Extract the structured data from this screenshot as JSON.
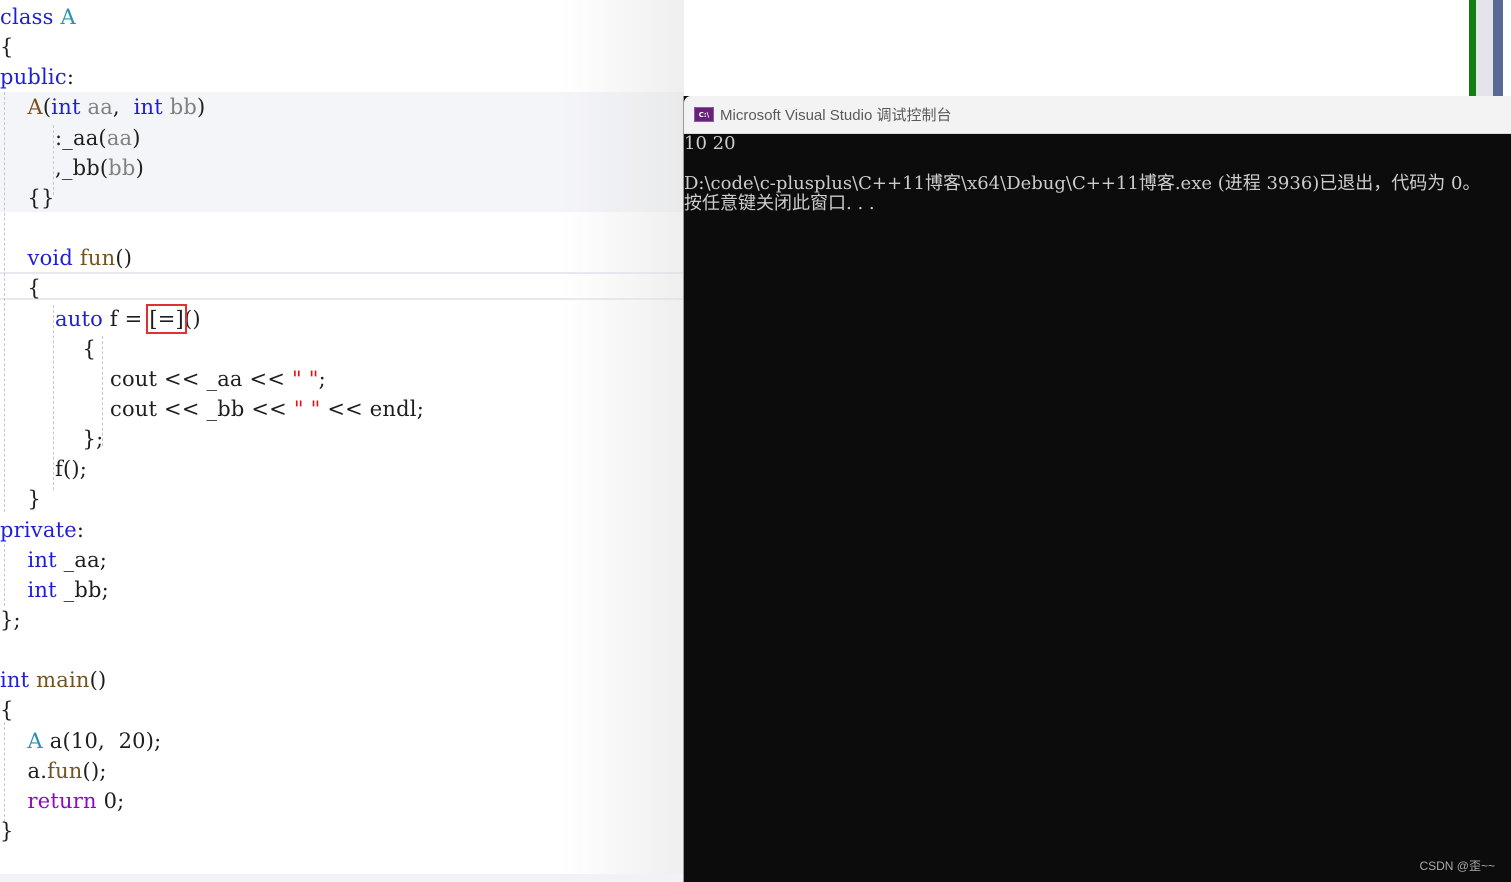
{
  "editor": {
    "lines": [
      {
        "tokens": [
          {
            "t": "class",
            "c": "kw"
          },
          {
            "t": " "
          },
          {
            "t": "A",
            "c": "cls"
          }
        ]
      },
      {
        "tokens": [
          {
            "t": "{"
          }
        ]
      },
      {
        "tokens": [
          {
            "t": "public",
            "c": "kw"
          },
          {
            "t": ":"
          }
        ]
      },
      {
        "tokens": [
          {
            "t": "    "
          },
          {
            "t": "A",
            "c": "fn"
          },
          {
            "t": "("
          },
          {
            "t": "int",
            "c": "kw"
          },
          {
            "t": " "
          },
          {
            "t": "aa",
            "c": "param"
          },
          {
            "t": ",  "
          },
          {
            "t": "int",
            "c": "kw"
          },
          {
            "t": " "
          },
          {
            "t": "bb",
            "c": "param"
          },
          {
            "t": ")"
          }
        ]
      },
      {
        "tokens": [
          {
            "t": "        :_aa("
          },
          {
            "t": "aa",
            "c": "param"
          },
          {
            "t": ")"
          }
        ]
      },
      {
        "tokens": [
          {
            "t": "        ,_bb("
          },
          {
            "t": "bb",
            "c": "param"
          },
          {
            "t": ")"
          }
        ]
      },
      {
        "tokens": [
          {
            "t": "    {}"
          }
        ]
      },
      {
        "tokens": []
      },
      {
        "tokens": [
          {
            "t": "    "
          },
          {
            "t": "void",
            "c": "kw"
          },
          {
            "t": " "
          },
          {
            "t": "fun",
            "c": "fn"
          },
          {
            "t": "()"
          }
        ]
      },
      {
        "tokens": [
          {
            "t": "    {"
          }
        ]
      },
      {
        "tokens": [
          {
            "t": "        "
          },
          {
            "t": "auto",
            "c": "kw"
          },
          {
            "t": " f = "
          },
          {
            "t": "[=]",
            "c": "capture"
          },
          {
            "t": "()"
          }
        ]
      },
      {
        "tokens": [
          {
            "t": "            {"
          }
        ]
      },
      {
        "tokens": [
          {
            "t": "                cout << _aa << "
          },
          {
            "t": "\" \"",
            "c": "str"
          },
          {
            "t": ";"
          }
        ]
      },
      {
        "tokens": [
          {
            "t": "                cout << _bb << "
          },
          {
            "t": "\" \"",
            "c": "str"
          },
          {
            "t": " << endl;"
          }
        ]
      },
      {
        "tokens": [
          {
            "t": "            };"
          }
        ]
      },
      {
        "tokens": [
          {
            "t": "        f();"
          }
        ]
      },
      {
        "tokens": [
          {
            "t": "    }"
          }
        ]
      },
      {
        "tokens": [
          {
            "t": "private",
            "c": "kw"
          },
          {
            "t": ":"
          }
        ]
      },
      {
        "tokens": [
          {
            "t": "    "
          },
          {
            "t": "int",
            "c": "kw"
          },
          {
            "t": " _aa;"
          }
        ]
      },
      {
        "tokens": [
          {
            "t": "    "
          },
          {
            "t": "int",
            "c": "kw"
          },
          {
            "t": " _bb;"
          }
        ]
      },
      {
        "tokens": [
          {
            "t": "};"
          }
        ]
      },
      {
        "tokens": []
      },
      {
        "tokens": [
          {
            "t": "int",
            "c": "kw"
          },
          {
            "t": " "
          },
          {
            "t": "main",
            "c": "fn"
          },
          {
            "t": "()"
          }
        ]
      },
      {
        "tokens": [
          {
            "t": "{"
          }
        ]
      },
      {
        "tokens": [
          {
            "t": "    "
          },
          {
            "t": "A",
            "c": "cls"
          },
          {
            "t": " a(10,  20);"
          }
        ]
      },
      {
        "tokens": [
          {
            "t": "    a."
          },
          {
            "t": "fun",
            "c": "fn"
          },
          {
            "t": "();"
          }
        ]
      },
      {
        "tokens": [
          {
            "t": "    "
          },
          {
            "t": "return",
            "c": "ret"
          },
          {
            "t": " 0;"
          }
        ]
      },
      {
        "tokens": [
          {
            "t": "}"
          }
        ]
      }
    ]
  },
  "console": {
    "title": "Microsoft Visual Studio 调试控制台",
    "icon": "console-app-icon",
    "icon_label": "C:\\",
    "output_lines": [
      "10 20",
      "",
      "D:\\code\\c-plusplus\\C++11博客\\x64\\Debug\\C++11博客.exe (进程 3936)已退出，代码为 0。",
      "按任意键关闭此窗口. . ."
    ]
  },
  "watermark": "CSDN @歪~~",
  "colors": {
    "keyword": "#1f1fd6",
    "class_name": "#2b91af",
    "function": "#74531f",
    "parameter": "#808080",
    "string": "#e01010",
    "control_keyword": "#8f08c4",
    "capture_highlight": "#e03030",
    "console_bg": "#0c0c0c",
    "console_text": "#cccccc"
  }
}
